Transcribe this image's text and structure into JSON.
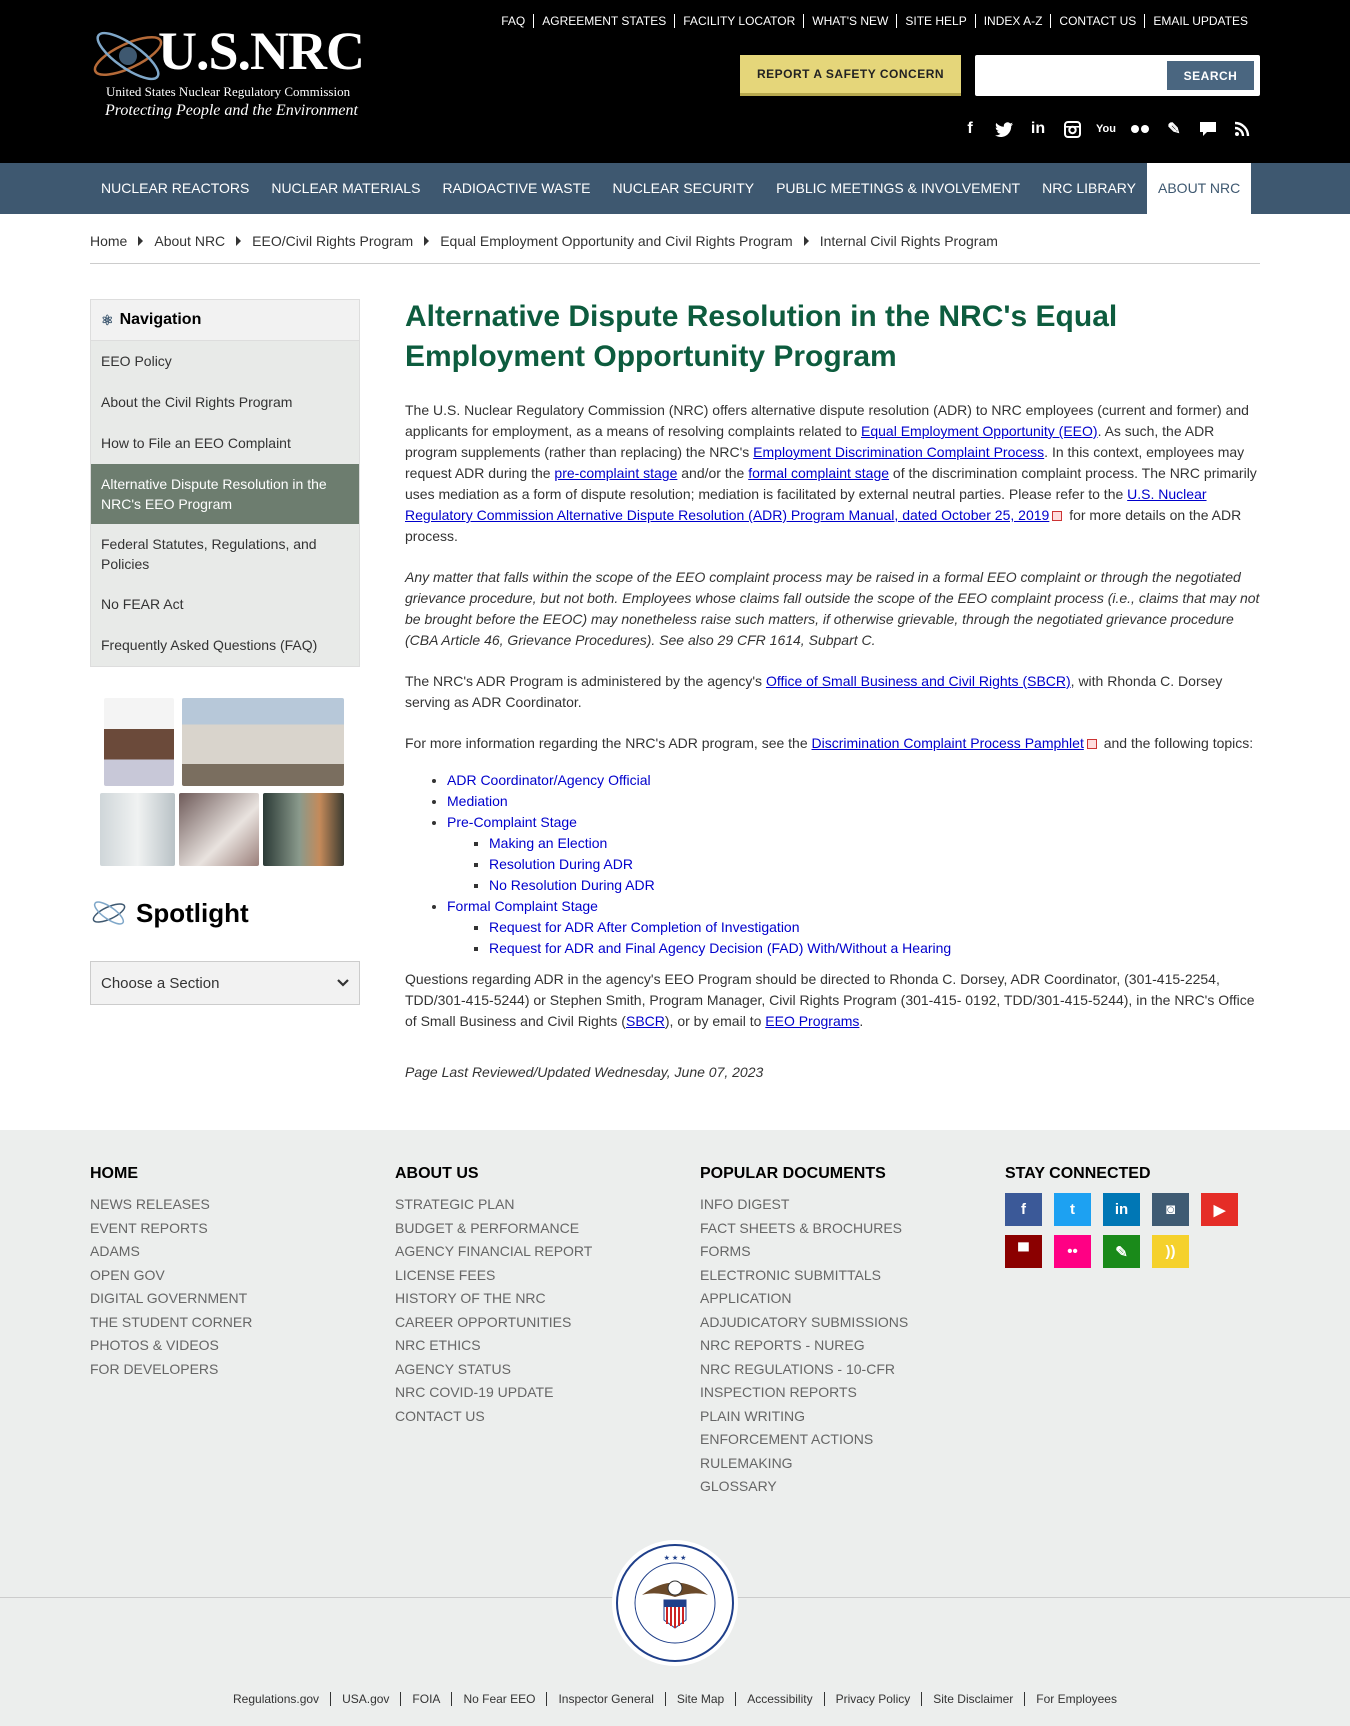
{
  "header": {
    "logo_title": "U.S.NRC",
    "logo_subtitle": "United States Nuclear Regulatory Commission",
    "logo_tagline": "Protecting People and the Environment",
    "top_links": [
      "FAQ",
      "AGREEMENT STATES",
      "FACILITY LOCATOR",
      "WHAT'S NEW",
      "SITE HELP",
      "INDEX A-Z",
      "CONTACT US",
      "EMAIL UPDATES"
    ],
    "report_button": "REPORT A SAFETY CONCERN",
    "search_value": "",
    "search_button": "SEARCH",
    "social_icons": [
      "facebook-icon",
      "twitter-icon",
      "linkedin-icon",
      "instagram-icon",
      "youtube-icon",
      "flickr-icon",
      "blog-pencil-icon",
      "comment-icon",
      "rss-icon"
    ]
  },
  "nav": {
    "items": [
      "NUCLEAR REACTORS",
      "NUCLEAR MATERIALS",
      "RADIOACTIVE WASTE",
      "NUCLEAR SECURITY",
      "PUBLIC MEETINGS & INVOLVEMENT",
      "NRC LIBRARY",
      "ABOUT NRC"
    ],
    "active": "ABOUT NRC"
  },
  "breadcrumb": [
    "Home",
    "About NRC",
    "EEO/Civil Rights Program",
    "Equal Employment Opportunity and Civil Rights Program",
    "Internal Civil Rights Program"
  ],
  "sidebar": {
    "title": "Navigation",
    "items": [
      "EEO Policy",
      "About the Civil Rights Program",
      "How to File an EEO Complaint",
      "Alternative Dispute Resolution in the NRC's EEO Program",
      "Federal Statutes, Regulations, and Policies",
      "No FEAR Act",
      "Frequently Asked Questions (FAQ)"
    ],
    "active_index": 3,
    "spotlight_title": "Spotlight",
    "choose_section": "Choose a Section"
  },
  "main": {
    "title": "Alternative Dispute Resolution in the NRC's Equal Employment Opportunity Program",
    "p1": {
      "t1": "The U.S. Nuclear Regulatory Commission (NRC) offers alternative dispute resolution (ADR) to NRC employees (current and former) and applicants for employment, as a means of resolving complaints related to ",
      "l1": "Equal Employment Opportunity (EEO)",
      "t2": ". As such, the ADR program supplements (rather than replacing) the NRC's ",
      "l2": "Employment Discrimination Complaint Process",
      "t3": ". In this context, employees may request ADR during the ",
      "l3": "pre-complaint stage",
      "t4": " and/or the ",
      "l4": "formal complaint stage",
      "t5": " of the discrimination complaint process. The NRC primarily uses mediation as a form of dispute resolution; mediation is facilitated by external neutral parties. Please refer to the ",
      "l5": "U.S. Nuclear Regulatory Commission Alternative Dispute Resolution (ADR) Program Manual, dated October 25, 2019",
      "t6": " for more details on the ADR process."
    },
    "p2": "Any matter that falls within the scope of the EEO complaint process may be raised in a formal EEO complaint or through the negotiated grievance procedure, but not both. Employees whose claims fall outside the scope of the EEO complaint process (i.e., claims that may not be brought before the EEOC) may nonetheless raise such matters, if otherwise grievable, through the negotiated grievance procedure (CBA Article 46, Grievance Procedures). See also 29 CFR 1614, Subpart C.",
    "p3": {
      "t1": "The NRC's ADR Program is administered by the agency's ",
      "l1": "Office of Small Business and Civil Rights (SBCR)",
      "t2": ", with Rhonda C. Dorsey serving as ADR Coordinator."
    },
    "p4": {
      "t1": "For more information regarding the NRC's ADR program, see the ",
      "l1": "Discrimination Complaint Process Pamphlet",
      "t2": " and the following topics:"
    },
    "topics": {
      "a": "ADR Coordinator/Agency Official",
      "b": "Mediation",
      "c": "Pre-Complaint Stage",
      "c1": "Making an Election",
      "c2": "Resolution During ADR",
      "c3": "No Resolution During ADR",
      "d": "Formal Complaint Stage",
      "d1": "Request for ADR After Completion of Investigation",
      "d2": "Request for ADR and Final Agency Decision (FAD) With/Without a Hearing"
    },
    "p5": {
      "t1": "Questions regarding ADR in the agency's EEO Program should be directed to Rhonda C. Dorsey, ADR Coordinator, (301-415-2254, TDD/301-415-5244) or Stephen Smith, Program Manager, Civil Rights Program (301-415- 0192, TDD/301-415-5244), in the NRC's Office of Small Business and Civil Rights (",
      "l1": "SBCR",
      "t2": "), or by email to ",
      "l2": "EEO Programs",
      "t3": "."
    },
    "last_reviewed": "Page Last Reviewed/Updated Wednesday, June 07, 2023"
  },
  "footer": {
    "home": {
      "title": "HOME",
      "links": [
        "NEWS RELEASES",
        "EVENT REPORTS",
        "ADAMS",
        "OPEN GOV",
        "DIGITAL GOVERNMENT",
        "THE STUDENT CORNER",
        "PHOTOS & VIDEOS",
        "FOR DEVELOPERS"
      ]
    },
    "about": {
      "title": "ABOUT US",
      "links": [
        "STRATEGIC PLAN",
        "BUDGET & PERFORMANCE",
        "AGENCY FINANCIAL REPORT",
        "LICENSE FEES",
        "HISTORY OF THE NRC",
        "CAREER OPPORTUNITIES",
        "NRC ETHICS",
        "AGENCY STATUS",
        "NRC COVID-19 UPDATE",
        "CONTACT US"
      ]
    },
    "popular": {
      "title": "POPULAR DOCUMENTS",
      "links": [
        "INFO DIGEST",
        "FACT SHEETS & BROCHURES",
        "FORMS",
        "ELECTRONIC SUBMITTALS",
        "APPLICATION",
        "ADJUDICATORY SUBMISSIONS",
        "NRC REPORTS - NUREG",
        "NRC REGULATIONS - 10-CFR",
        "INSPECTION REPORTS",
        "PLAIN WRITING",
        "ENFORCEMENT ACTIONS",
        "RULEMAKING",
        "GLOSSARY"
      ]
    },
    "connected": {
      "title": "STAY CONNECTED",
      "icons": [
        {
          "name": "facebook-icon",
          "glyph": "f",
          "color": "#3b5998"
        },
        {
          "name": "twitter-icon",
          "glyph": "t",
          "color": "#1da1f2"
        },
        {
          "name": "linkedin-icon",
          "glyph": "in",
          "color": "#0077b5"
        },
        {
          "name": "instagram-icon",
          "glyph": "◙",
          "color": "#3f5b73"
        },
        {
          "name": "youtube-icon",
          "glyph": "▶",
          "color": "#e52d27"
        },
        {
          "name": "comment-icon",
          "glyph": "▀",
          "color": "#8b0000"
        },
        {
          "name": "flickr-icon",
          "glyph": "••",
          "color": "#ff0084"
        },
        {
          "name": "blog-pencil-icon",
          "glyph": "✎",
          "color": "#1a8a1a"
        },
        {
          "name": "rss-icon",
          "glyph": "))",
          "color": "#f5d12c"
        }
      ]
    },
    "bottom_links": [
      "Regulations.gov",
      "USA.gov",
      "FOIA",
      "No Fear EEO",
      "Inspector General",
      "Site Map",
      "Accessibility",
      "Privacy Policy",
      "Site Disclaimer",
      "For Employees"
    ]
  }
}
